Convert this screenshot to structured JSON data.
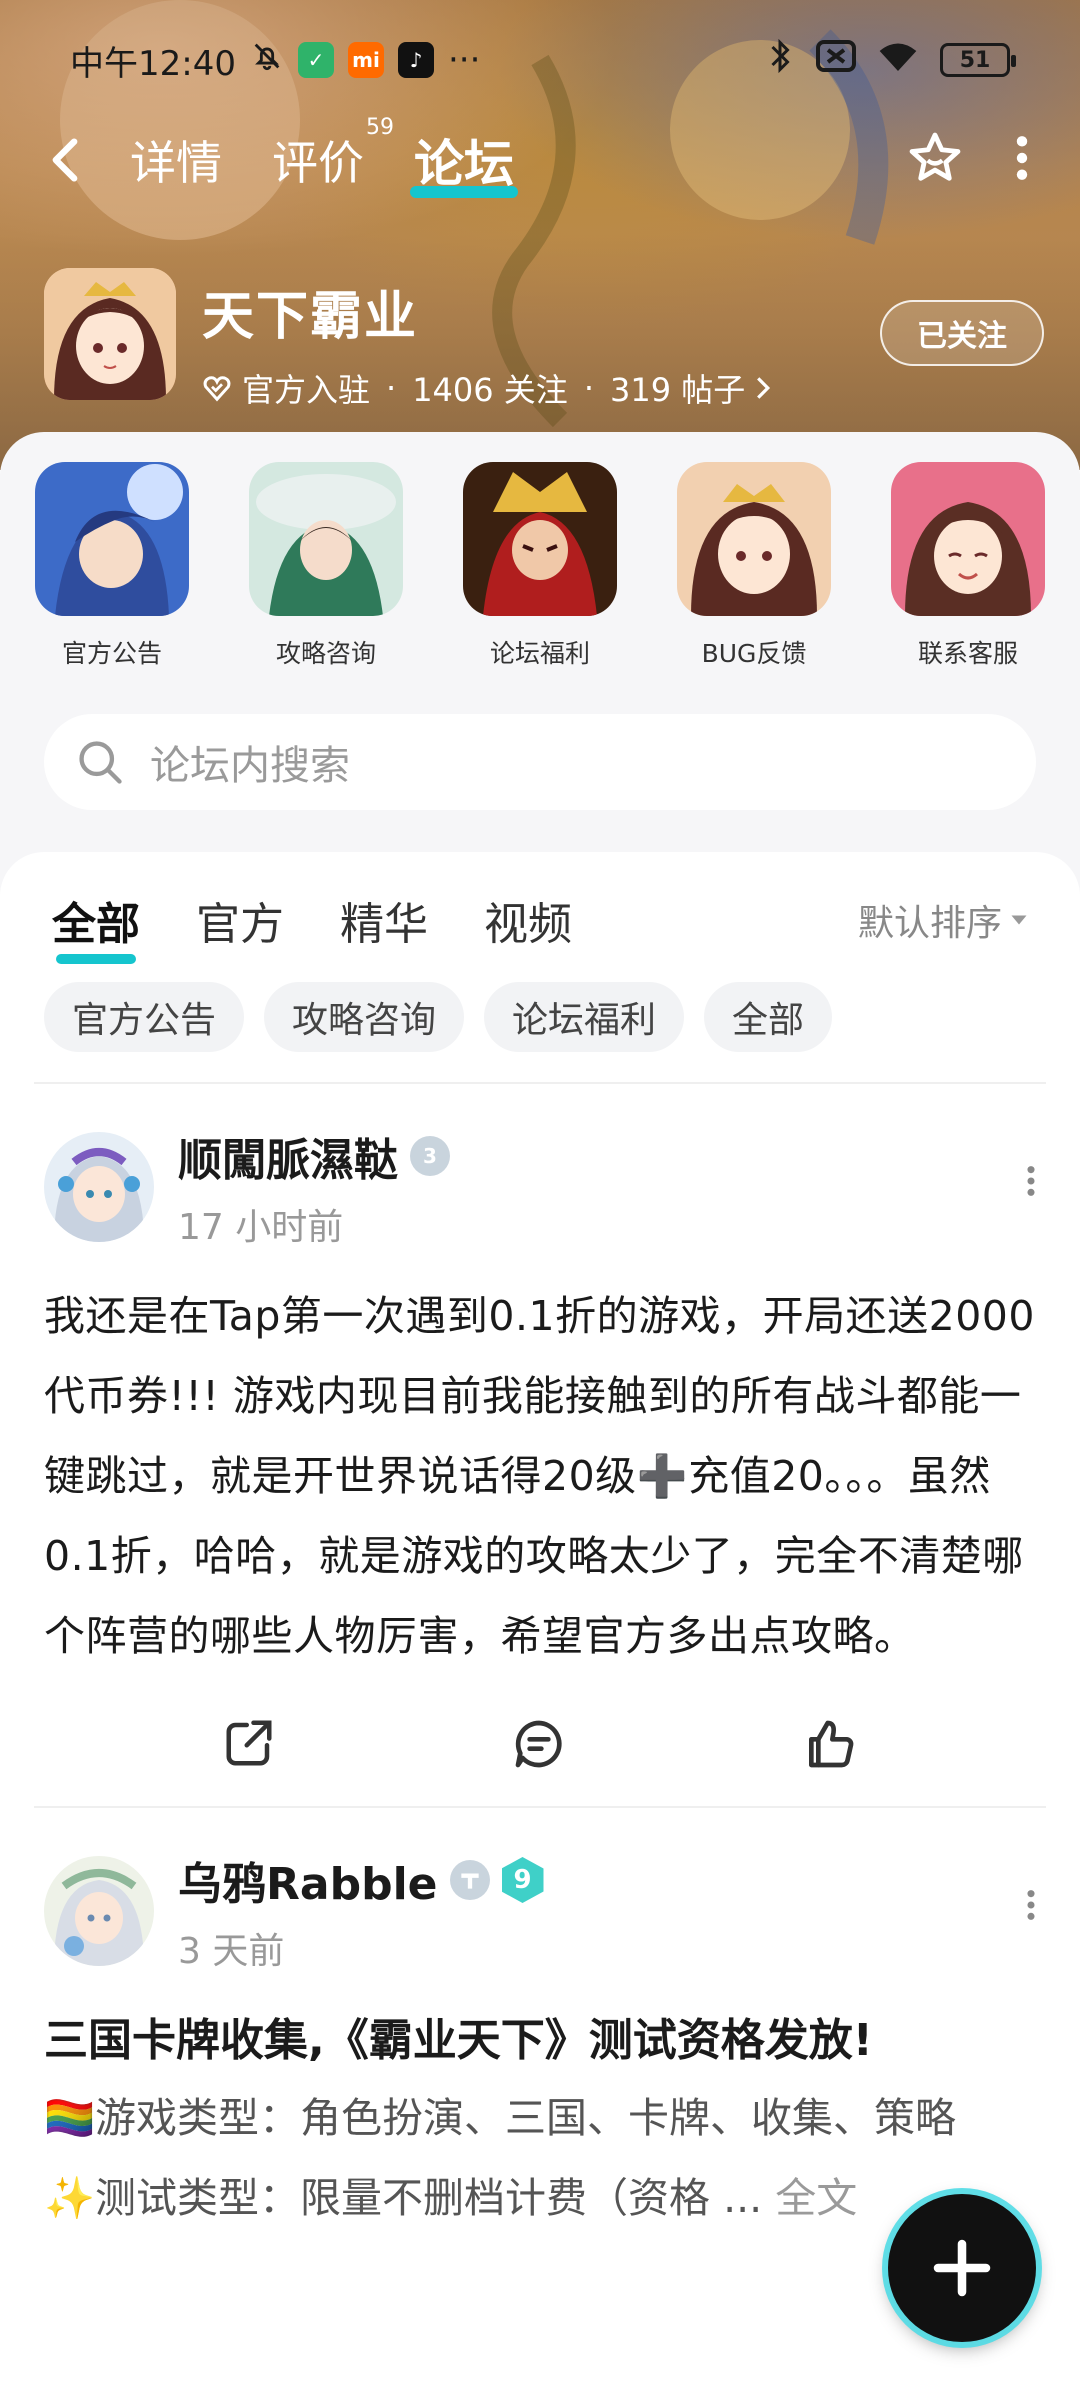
{
  "status_bar": {
    "time": "中午12:40",
    "dots": "···",
    "battery": "51",
    "mi_label": "mi"
  },
  "nav": {
    "tabs": [
      {
        "label": "详情"
      },
      {
        "label": "评价",
        "badge": "59"
      },
      {
        "label": "论坛"
      }
    ]
  },
  "game": {
    "title": "天下霸业",
    "official": "官方入驻",
    "follows": "1406 关注",
    "posts": "319 帖子",
    "separator": "·",
    "follow_button": "已关注"
  },
  "quick_links": [
    {
      "label": "官方公告"
    },
    {
      "label": "攻略咨询"
    },
    {
      "label": "论坛福利"
    },
    {
      "label": "BUG反馈"
    },
    {
      "label": "联系客服"
    }
  ],
  "search": {
    "placeholder": "论坛内搜索"
  },
  "filter_tabs": [
    {
      "label": "全部"
    },
    {
      "label": "官方"
    },
    {
      "label": "精华"
    },
    {
      "label": "视频"
    }
  ],
  "sort_label": "默认排序",
  "chips": [
    {
      "label": "官方公告"
    },
    {
      "label": "攻略咨询"
    },
    {
      "label": "论坛福利"
    },
    {
      "label": "全部"
    }
  ],
  "posts": [
    {
      "username": "顺闖脈濕鞑",
      "level_badge": "3",
      "time": "17 小时前",
      "body": "我还是在Tap第一次遇到0.1折的游戏，开局还送2000代币券!!! 游戏内现目前我能接触到的所有战斗都能一键跳过，就是开世界说话得20级➕充值20。。。虽然0.1折，哈哈，就是游戏的攻略太少了，完全不清楚哪个阵营的哪些人物厉害，希望官方多出点攻略。"
    },
    {
      "username": "乌鸦Rabble",
      "level_badge": "9",
      "time": "3 天前",
      "title": "三国卡牌收集,《霸业天下》测试资格发放!",
      "line1": "🏳️‍🌈游戏类型：角色扮演、三国、卡牌、收集、策略",
      "line2": "✨测试类型：限量不删档计费（资格 ...",
      "read_full": "全文"
    }
  ]
}
